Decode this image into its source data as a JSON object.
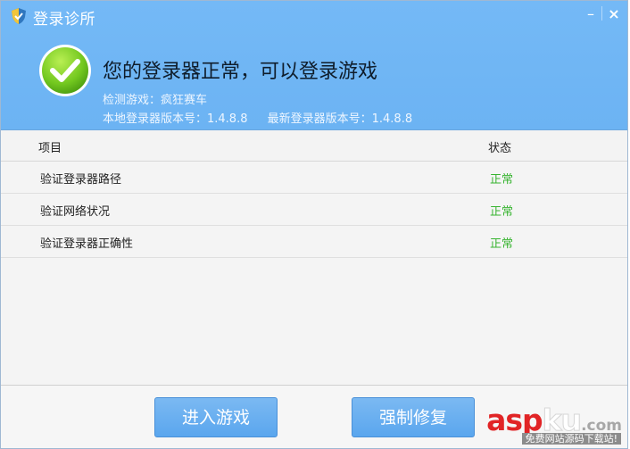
{
  "window": {
    "title": "登录诊所",
    "minimize_label": "–",
    "close_label": "×"
  },
  "status": {
    "message": "您的登录器正常，可以登录游戏",
    "detected_game": "检测游戏：疯狂赛车",
    "local_version": "本地登录器版本号：1.4.8.8",
    "latest_version": "最新登录器版本号：1.4.8.8"
  },
  "table": {
    "columns": [
      "项目",
      "状态"
    ],
    "rows": [
      {
        "item": "验证登录器路径",
        "status": "正常"
      },
      {
        "item": "验证网络状况",
        "status": "正常"
      },
      {
        "item": "验证登录器正确性",
        "status": "正常"
      }
    ]
  },
  "footer": {
    "enter_game_label": "进入游戏",
    "force_repair_label": "强制修复"
  },
  "watermark": {
    "brand_asp": "asp",
    "brand_ku": "ku",
    "brand_suffix": ".com",
    "subtitle": "免费网站源码下载站!"
  },
  "colors": {
    "header_blue": "#6cb3f3",
    "status_green": "#38b431",
    "button_blue": "#5aa6ee",
    "watermark_red": "#e12426"
  },
  "icons": {
    "logo": "shield-icon",
    "status": "check-circle-icon"
  }
}
